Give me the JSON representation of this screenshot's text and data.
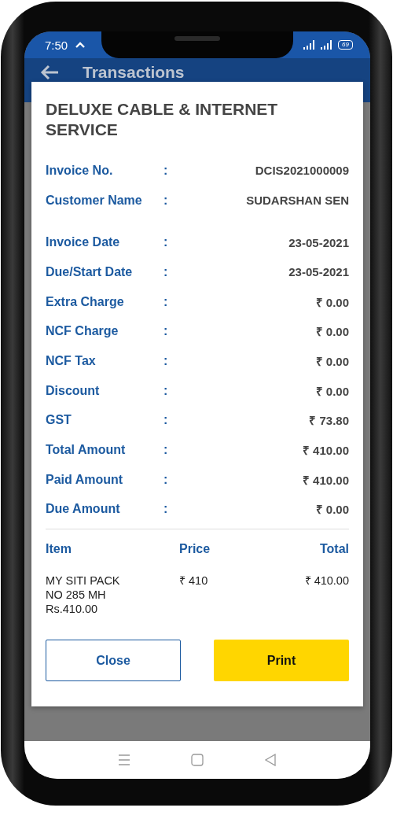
{
  "status_bar": {
    "time": "7:50",
    "battery": "69"
  },
  "app_bar": {
    "title": "Transactions"
  },
  "dialog": {
    "title": "DELUXE CABLE & INTERNET SERVICE",
    "header_fields": [
      {
        "label": "Invoice No.",
        "separator": ":",
        "value": "DCIS2021000009"
      },
      {
        "label": "Customer Name",
        "separator": ":",
        "value": "SUDARSHAN SEN"
      }
    ],
    "fields": [
      {
        "label": "Invoice Date",
        "separator": ":",
        "value": "23-05-2021"
      },
      {
        "label": "Due/Start Date",
        "separator": ":",
        "value": "23-05-2021"
      },
      {
        "label": "Extra Charge",
        "separator": ":",
        "value": "₹ 0.00"
      },
      {
        "label": "NCF Charge",
        "separator": ":",
        "value": "₹ 0.00"
      },
      {
        "label": "NCF Tax",
        "separator": ":",
        "value": "₹ 0.00"
      },
      {
        "label": "Discount",
        "separator": ":",
        "value": "₹ 0.00"
      },
      {
        "label": "GST",
        "separator": ":",
        "value": "₹ 73.80"
      },
      {
        "label": "Total Amount",
        "separator": ":",
        "value": "₹ 410.00"
      },
      {
        "label": "Paid Amount",
        "separator": ":",
        "value": "₹ 410.00"
      },
      {
        "label": "Due Amount",
        "separator": ":",
        "value": "₹ 0.00"
      }
    ],
    "table": {
      "columns": [
        "Item",
        "Price",
        "Total"
      ],
      "rows": [
        {
          "item": [
            "MY SITI PACK",
            "NO 285 MH",
            "Rs.410.00"
          ],
          "price": "₹ 410",
          "total": "₹ 410.00"
        }
      ]
    },
    "buttons": [
      {
        "label": "Close",
        "kind": "outline"
      },
      {
        "label": "Print",
        "kind": "primary"
      }
    ]
  }
}
